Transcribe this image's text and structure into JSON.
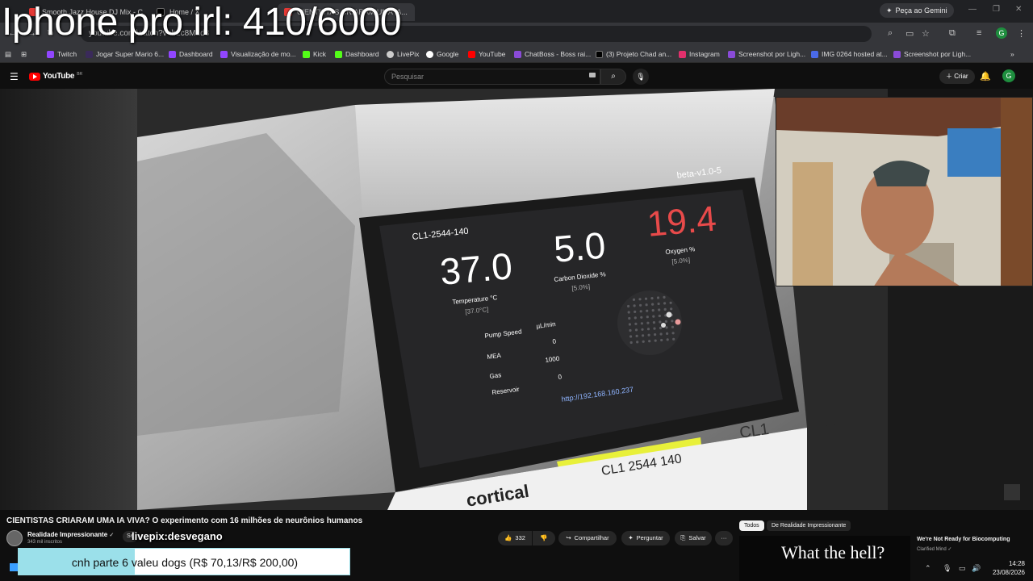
{
  "browser": {
    "tabs": [
      {
        "label": "Smooth Jazz House DJ Mix - C...",
        "fav_color": "#e53935"
      },
      {
        "label": "Home / X",
        "fav_color": "#000000"
      },
      {
        "label": "CIENTISTAS CRIARAM UMA IA...",
        "fav_color": "#e53935"
      }
    ],
    "gemini_label": "Peça ao Gemini",
    "url": "youtube.com/watch?v=b2c8M1d8",
    "profile_initial": "G",
    "bookmarks": [
      {
        "label": "Twitch",
        "color": "#9146ff"
      },
      {
        "label": "Jogar Super Mario 6...",
        "color": "#3a2a5a"
      },
      {
        "label": "Dashboard",
        "color": "#9146ff"
      },
      {
        "label": "Visualização de mo...",
        "color": "#9146ff"
      },
      {
        "label": "Kick",
        "color": "#53fc18"
      },
      {
        "label": "Dashboard",
        "color": "#53fc18"
      },
      {
        "label": "LivePix",
        "color": "#cccccc"
      },
      {
        "label": "Google",
        "color": "#ffffff"
      },
      {
        "label": "YouTube",
        "color": "#ff0000"
      },
      {
        "label": "ChatBoss - Boss rai...",
        "color": "#8a4bd8"
      },
      {
        "label": "(3) Projeto Chad an...",
        "color": "#000000"
      },
      {
        "label": "Instagram",
        "color": "#e1306c"
      },
      {
        "label": "Screenshot por Ligh...",
        "color": "#8a4bd8"
      },
      {
        "label": "IMG 0264 hosted at...",
        "color": "#4a6ae8"
      },
      {
        "label": "Screenshot por Ligh...",
        "color": "#8a4bd8"
      }
    ]
  },
  "overlay": {
    "stream_title": "Iphone pro irl: 410/6000"
  },
  "youtube": {
    "logo_text": "YouTube",
    "country": "BR",
    "search_placeholder": "Pesquisar",
    "create_label": "Criar",
    "avatar_initial": "G"
  },
  "device_screen": {
    "version": "beta-v1.0-5",
    "device_id": "CL1-2544-140",
    "temperature": {
      "value": "37.0",
      "label": "Temperature °C",
      "target": "[37.0°C]"
    },
    "co2": {
      "value": "5.0",
      "label": "Carbon Dioxide %",
      "target": "[5.0%]"
    },
    "oxygen": {
      "value": "19.4",
      "label": "Oxygen %",
      "target": "[5.0%]"
    },
    "pump": {
      "header": "Pump Speed",
      "unit": "µL/min",
      "rows": [
        {
          "label": "MEA",
          "value": "0"
        },
        {
          "label": "Gas",
          "value": "1000"
        },
        {
          "label": "Reservoir",
          "value": "0"
        }
      ]
    },
    "url": "http://192.168.160.237",
    "device_label": "CL1",
    "sticker": "CL1 2544 140",
    "brand": "cortical"
  },
  "video_info": {
    "title": "CIENTISTAS CRIARAM UMA IA VIVA? O experimento com 16 milhões de neurônios humanos",
    "channel": "Realidade Impressionante",
    "subs": "343 mil inscritos",
    "subscribe_label": "Se",
    "livepix_overlay": "livepix:desvegano",
    "likes": "332",
    "share_label": "Compartilhar",
    "ask_label": "Perguntar",
    "save_label": "Salvar",
    "more_label": "···"
  },
  "recommendations": {
    "chips": [
      "Todos",
      "De Realidade Impressionante"
    ],
    "items": [
      {
        "thumb_text": "What the hell?",
        "title": "We're Not Ready for Biocomputing",
        "channel": "Clarified Mind"
      }
    ]
  },
  "donation": {
    "text": "cnh parte 6 valeu dogs (R$ 70,13/R$ 200,00)",
    "raised": 70.13,
    "goal": 200.0
  },
  "taskbar": {
    "time": "14:28",
    "date": "23/08/2026"
  }
}
